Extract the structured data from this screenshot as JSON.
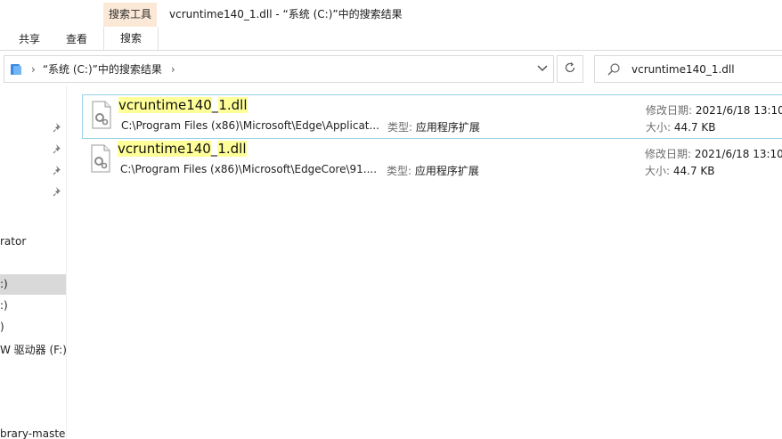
{
  "window": {
    "context_tab": "搜索工具",
    "title": "vcruntime140_1.dll - “系统 (C:)”中的搜索结果"
  },
  "ribbon": {
    "tabs": [
      "共享",
      "查看",
      "搜索"
    ],
    "active_tab": "搜索"
  },
  "address": {
    "path": "“系统 (C:)”中的搜索结果"
  },
  "search": {
    "query": "vcruntime140_1.dll"
  },
  "nav": {
    "items": [
      "rator",
      ":)",
      ":)",
      ")",
      "W 驱动器 (F:)",
      "brary-maste"
    ]
  },
  "results": [
    {
      "name_hl1": "vcruntime140",
      "name_mid": "_",
      "name_hl2": "1.dll",
      "path": "C:\\Program Files (x86)\\Microsoft\\Edge\\Applicat...",
      "type_label": "类型:",
      "type_value": "应用程序扩展",
      "date_label": "修改日期:",
      "date_value": "2021/6/18 13:10",
      "size_label": "大小:",
      "size_value": "44.7 KB"
    },
    {
      "name_hl1": "vcruntime140",
      "name_mid": "_",
      "name_hl2": "1.dll",
      "path": "C:\\Program Files (x86)\\Microsoft\\EdgeCore\\91....",
      "type_label": "类型:",
      "type_value": "应用程序扩展",
      "date_label": "修改日期:",
      "date_value": "2021/6/18 13:10",
      "size_label": "大小:",
      "size_value": "44.7 KB"
    }
  ],
  "icons": {
    "address_folder": "folder-icon",
    "refresh": "refresh-icon",
    "search": "search-icon",
    "pin": "pin-icon",
    "file": "dll-file-icon"
  }
}
